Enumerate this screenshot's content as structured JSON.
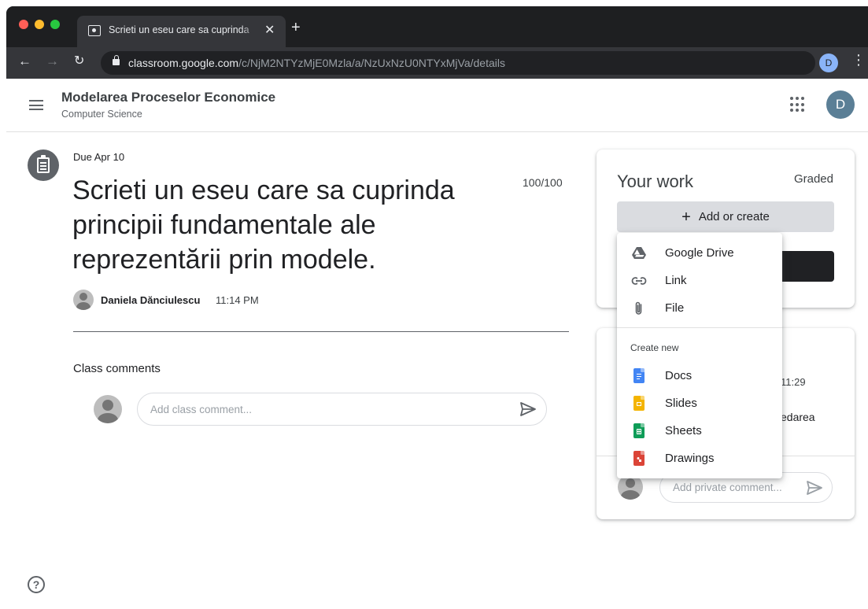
{
  "browser": {
    "tab_title": "Scrieti un eseu care sa cuprinda",
    "tab_close": "✕",
    "new_tab": "+",
    "url_host": "classroom.google.com",
    "url_path": "/c/NjM2NTYzMjE0Mzla/a/NzUxNzU0NTYxMjVa/details",
    "profile_initial": "D",
    "icons": [
      "back-arrow-icon",
      "forward-arrow-icon",
      "reload-icon",
      "lock-icon",
      "star-icon",
      "chrome-menu-icon"
    ]
  },
  "header": {
    "class_name": "Modelarea Proceselor Economice",
    "section": "Computer Science",
    "account_initial": "D"
  },
  "assignment": {
    "due": "Due Apr 10",
    "title": "Scrieti un eseu care sa cuprinda principii fundamentale ale reprezentării prin modele.",
    "points": "100/100",
    "author": "Daniela Dănciulescu",
    "time": "11:14 PM"
  },
  "comments": {
    "title": "Class comments",
    "placeholder": "Add class comment..."
  },
  "your_work": {
    "title": "Your work",
    "status": "Graded",
    "add_label": "Add or create"
  },
  "private_comments": {
    "time": "11:29",
    "text": "edarea",
    "placeholder": "Add private comment..."
  },
  "menu": {
    "attach_items": [
      {
        "label": "Google Drive",
        "icon": "google-drive-icon"
      },
      {
        "label": "Link",
        "icon": "link-icon"
      },
      {
        "label": "File",
        "icon": "paperclip-icon"
      }
    ],
    "section_label": "Create new",
    "create_items": [
      {
        "label": "Docs",
        "icon": "docs-icon",
        "color": "#4285f4"
      },
      {
        "label": "Slides",
        "icon": "slides-icon",
        "color": "#f4b400"
      },
      {
        "label": "Sheets",
        "icon": "sheets-icon",
        "color": "#0f9d58"
      },
      {
        "label": "Drawings",
        "icon": "drawings-icon",
        "color": "#db4437"
      }
    ]
  },
  "colors": {
    "chrome_dark": "#202124",
    "chrome_toolbar": "#35363a",
    "account_avatar": "#5b7f96",
    "button_gray": "#dadce0"
  }
}
